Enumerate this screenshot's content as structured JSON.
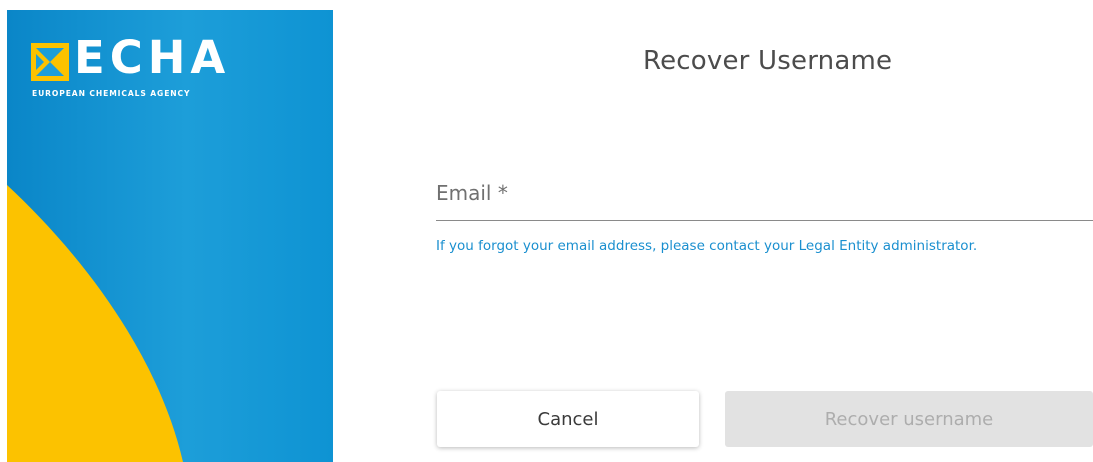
{
  "brand": {
    "logo_text": "ECHA",
    "logo_subtitle": "EUROPEAN CHEMICALS AGENCY",
    "colors": {
      "blue": "#1d9ed9",
      "yellow": "#fcc200"
    }
  },
  "form": {
    "title": "Recover Username",
    "email": {
      "label": "Email *",
      "value": "",
      "placeholder": ""
    },
    "hint": "If you forgot your email address, please contact your Legal Entity administrator.",
    "cancel_label": "Cancel",
    "submit_label": "Recover username",
    "submit_disabled": true
  }
}
